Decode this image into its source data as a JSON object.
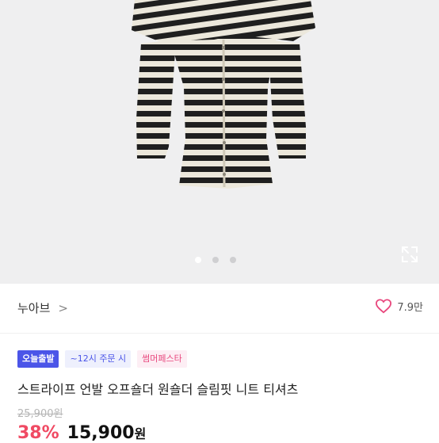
{
  "gallery": {
    "image_icon": "striped-off-shoulder-top-photo",
    "slide_count": 3,
    "active_slide": 1,
    "expand_icon": "expand-icon"
  },
  "brand": {
    "name": "누아브",
    "chevron": ">",
    "like_count": "7.9만",
    "like_icon": "heart-outline-icon"
  },
  "badges": [
    {
      "label": "오늘출발"
    },
    {
      "label": "~12시 주문 시"
    },
    {
      "label": "썸머페스타"
    }
  ],
  "product": {
    "title": "스트라이프 언발 오프숄더 원숄더 슬림핏 니트 티셔츠",
    "original_price": "25,900원",
    "discount": "38%",
    "sale_price": "15,900",
    "currency": "원"
  },
  "colors": {
    "badge_primary": "#4b55e8",
    "discount_red": "#f04a63",
    "heart": "#e8477d"
  }
}
